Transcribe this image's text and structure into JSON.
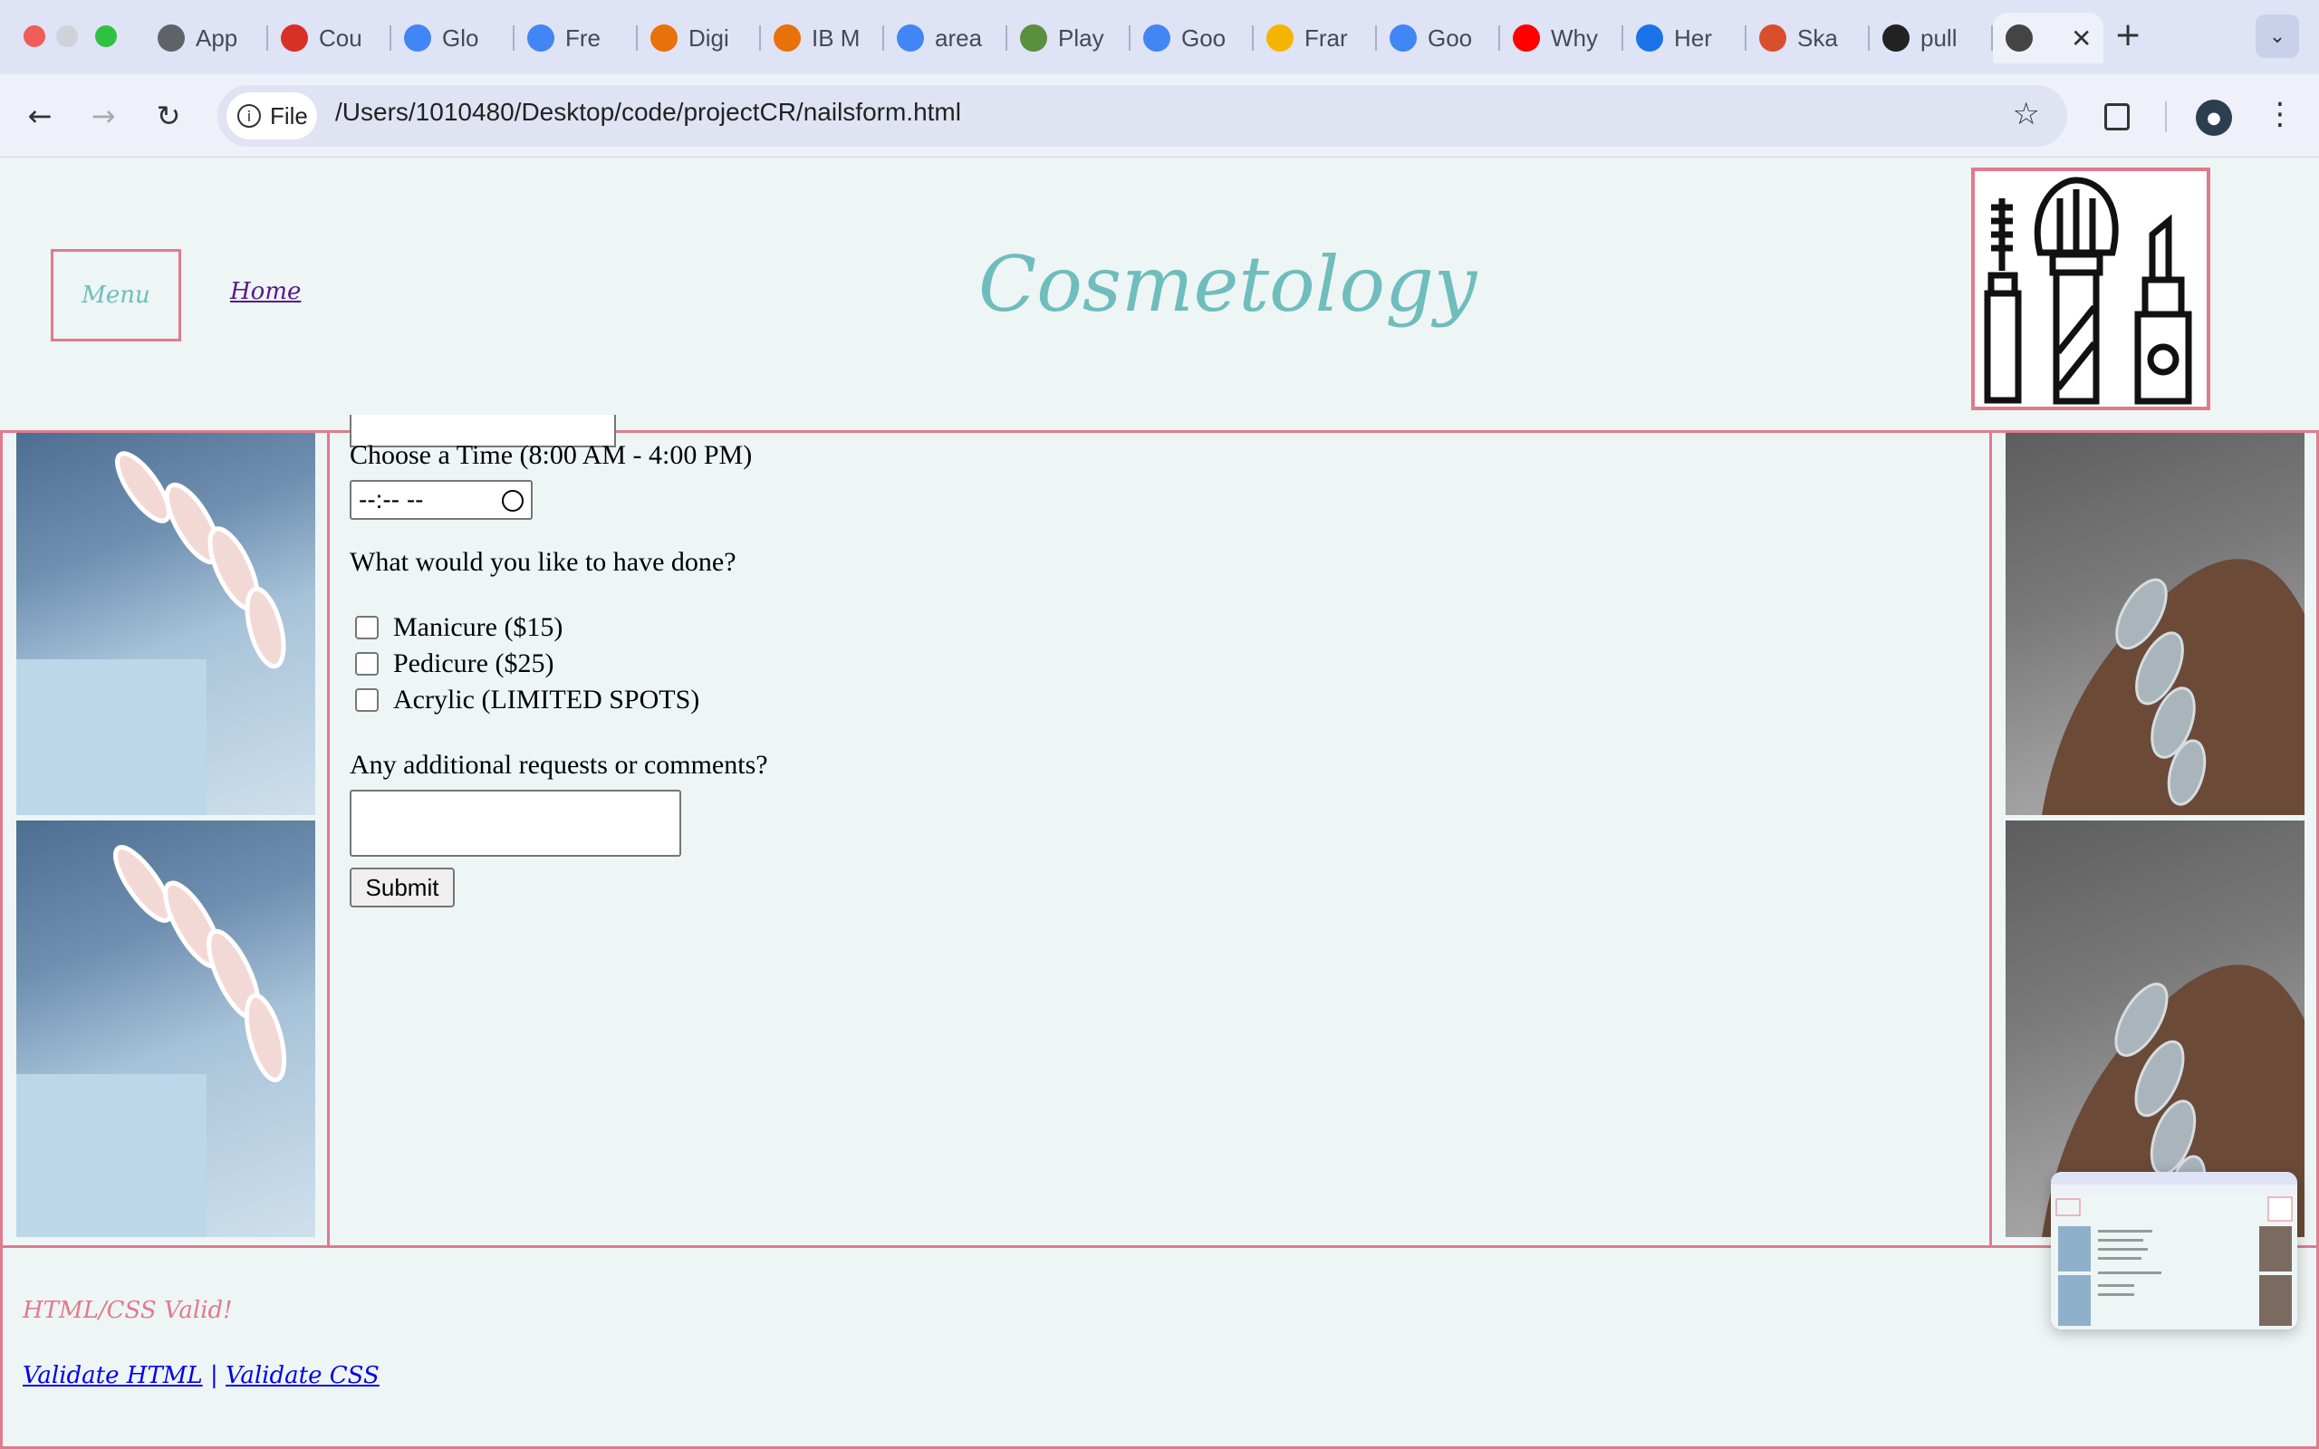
{
  "browser": {
    "tabs": [
      {
        "label": "App",
        "icon": "globe-icon",
        "color": "#5f6368"
      },
      {
        "label": "Cou",
        "icon": "gear-red-icon",
        "color": "#d93025"
      },
      {
        "label": "Glo",
        "icon": "cloud-icon",
        "color": "#4285f4"
      },
      {
        "label": "Fre",
        "icon": "docs-icon",
        "color": "#4285f4"
      },
      {
        "label": "Digi",
        "icon": "e-logo-icon",
        "color": "#e8710a"
      },
      {
        "label": "IB M",
        "icon": "e-logo-icon",
        "color": "#e8710a"
      },
      {
        "label": "area",
        "icon": "google-icon",
        "color": "#4285f4"
      },
      {
        "label": "Play",
        "icon": "chess-pawn-icon",
        "color": "#5a8f3c"
      },
      {
        "label": "Goo",
        "icon": "google-icon",
        "color": "#4285f4"
      },
      {
        "label": "Frar",
        "icon": "slides-icon",
        "color": "#f4b400"
      },
      {
        "label": "Goo",
        "icon": "translate-icon",
        "color": "#4285f4"
      },
      {
        "label": "Why",
        "icon": "youtube-icon",
        "color": "#ff0000"
      },
      {
        "label": "Her",
        "icon": "css-icon",
        "color": "#1a73e8"
      },
      {
        "label": "Ska",
        "icon": "sb-icon",
        "color": "#d94f2b"
      },
      {
        "label": "pull",
        "icon": "github-icon",
        "color": "#222222"
      }
    ],
    "active_tab_icon": "makeup-icon",
    "new_tab": "+",
    "url_chip": "File",
    "url": "/Users/1010480/Desktop/code/projectCR/nailsform.html"
  },
  "site": {
    "menu_label": "Menu",
    "home_label": "Home",
    "title": "Cosmetology",
    "accent": "#e07a8c",
    "title_color": "#6fbdbd"
  },
  "form": {
    "time_label": "Choose a Time (8:00 AM - 4:00 PM)",
    "time_value": "--:-- --",
    "services_question": "What would you like to have done?",
    "services": [
      {
        "label": "Manicure ($15)",
        "checked": false
      },
      {
        "label": "Pedicure ($25)",
        "checked": false
      },
      {
        "label": "Acrylic (LIMITED SPOTS)",
        "checked": false
      }
    ],
    "comments_label": "Any additional requests or comments?",
    "comments_value": "",
    "submit_label": "Submit"
  },
  "footer": {
    "valid_text": "HTML/CSS Valid!",
    "validate_html": "Validate HTML",
    "separator": "|",
    "validate_css": "Validate CSS"
  }
}
